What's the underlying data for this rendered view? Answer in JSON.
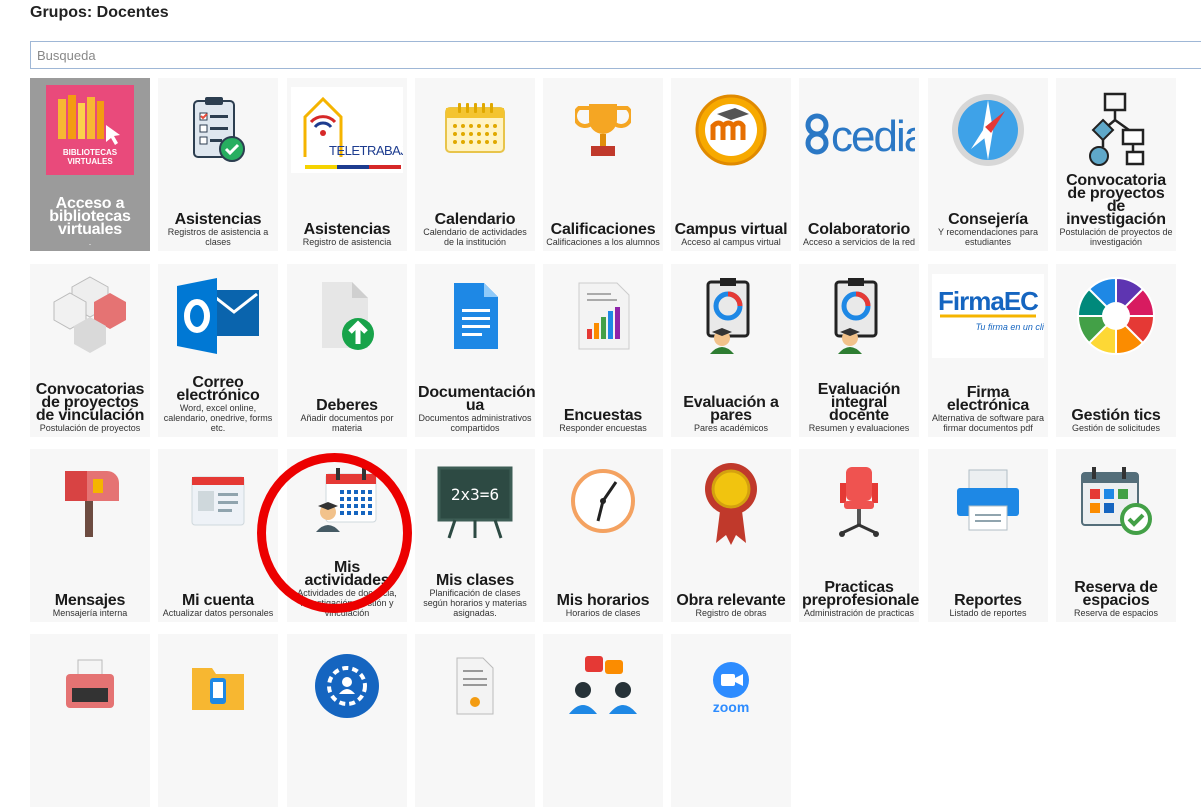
{
  "header": {
    "title": "Grupos: Docentes"
  },
  "search": {
    "placeholder": "Busqueda"
  },
  "tiles": [
    {
      "title": "Acceso a bibliotecas virtuales",
      "desc": ".",
      "icon": "bibliotecas-virtuales-icon",
      "icon_label": "BIBLIOTECAS VIRTUALES"
    },
    {
      "title": "Asistencias",
      "desc": "Registros de asistencia a clases",
      "icon": "checklist-icon"
    },
    {
      "title": "Asistencias",
      "desc": "Registro de asistencia",
      "icon": "teletrabajo-logo-icon",
      "icon_label": "TELETRABAJO"
    },
    {
      "title": "Calendario",
      "desc": "Calendario de actividades de la institución",
      "icon": "calendar-icon"
    },
    {
      "title": "Calificaciones",
      "desc": "Calificaciones a los alumnos",
      "icon": "trophy-icon"
    },
    {
      "title": "Campus virtual",
      "desc": "Acceso al campus virtual",
      "icon": "moodle-icon"
    },
    {
      "title": "Colaboratorio",
      "desc": "Acceso a servicios de la red",
      "icon": "cedia-logo-icon",
      "icon_label": "cedia"
    },
    {
      "title": "Consejería",
      "desc": "Y recomendaciones para estudiantes",
      "icon": "compass-icon"
    },
    {
      "title": "Convocatoria de proyectos de investigación",
      "desc": "Postulación de proyectos de investigación",
      "icon": "flowchart-icon"
    },
    {
      "title": "Convocatorias de proyectos de vinculación",
      "desc": "Postulación de proyectos",
      "icon": "cubes-icon"
    },
    {
      "title": "Correo electrónico",
      "desc": "Word, excel online, calendario, onedrive, forms etc.",
      "icon": "outlook-icon"
    },
    {
      "title": "Deberes",
      "desc": "Añadir documentos por materia",
      "icon": "document-upload-icon"
    },
    {
      "title": "Documentación ua",
      "desc": "Documentos administrativos compartidos",
      "icon": "document-icon"
    },
    {
      "title": "Encuestas",
      "desc": "Responder encuestas",
      "icon": "survey-chart-icon"
    },
    {
      "title": "Evaluación a pares",
      "desc": "Pares académicos",
      "icon": "peer-evaluation-icon"
    },
    {
      "title": "Evaluación integral docente",
      "desc": "Resumen y evaluaciones",
      "icon": "teacher-evaluation-icon"
    },
    {
      "title": "Firma electrónica",
      "desc": "Alternativa de software para firmar documentos pdf",
      "icon": "firmaec-logo-icon",
      "icon_label": "FirmaEC",
      "icon_sub": "Tu firma en un clic"
    },
    {
      "title": "Gestión tics",
      "desc": "Gestión de solicitudes",
      "icon": "pie-wheel-icon"
    },
    {
      "title": "Mensajes",
      "desc": "Mensajería interna",
      "icon": "mailbox-icon"
    },
    {
      "title": "Mi cuenta",
      "desc": "Actualizar datos personales",
      "icon": "account-form-icon"
    },
    {
      "title": "Mis actividades",
      "desc": "Actividades de docencia, investigación, gestión y vinculación",
      "icon": "activities-calendar-icon"
    },
    {
      "title": "Mis clases",
      "desc": "Planificación de clases según horarios y materias asignadas.",
      "icon": "blackboard-icon",
      "icon_label": "2x3=6"
    },
    {
      "title": "Mis horarios",
      "desc": "Horarios de clases",
      "icon": "clock-icon"
    },
    {
      "title": "Obra relevante",
      "desc": "Registro de obras",
      "icon": "medal-icon"
    },
    {
      "title": "Practicas preprofesionales",
      "desc": "Administración de practicas",
      "icon": "office-chair-icon"
    },
    {
      "title": "Reportes",
      "desc": "Listado de reportes",
      "icon": "printer-icon"
    },
    {
      "title": "Reserva de espacios",
      "desc": "Reserva de espacios",
      "icon": "reservation-calendar-icon"
    },
    {
      "title": "",
      "desc": "",
      "icon": "typewriter-icon"
    },
    {
      "title": "",
      "desc": "",
      "icon": "folder-phone-icon"
    },
    {
      "title": "",
      "desc": "",
      "icon": "gear-user-icon"
    },
    {
      "title": "",
      "desc": "",
      "icon": "certificate-icon"
    },
    {
      "title": "",
      "desc": "",
      "icon": "discussion-icon"
    },
    {
      "title": "",
      "desc": "",
      "icon": "zoom-icon",
      "icon_label": "zoom"
    }
  ]
}
